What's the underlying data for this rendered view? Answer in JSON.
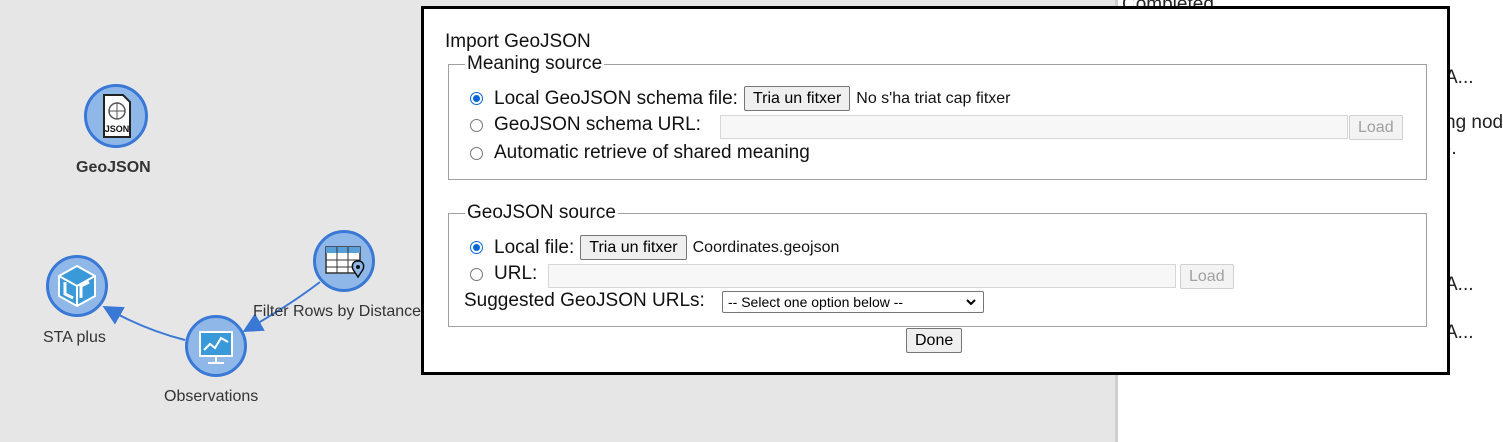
{
  "canvas": {
    "nodes": [
      {
        "label": "GeoJSON",
        "icon": "geojson-file-icon"
      },
      {
        "label": "STA plus",
        "icon": "sta-plus-cube-icon"
      },
      {
        "label": "Filter Rows by Distance",
        "icon": "table-pin-icon"
      },
      {
        "label": "Observations",
        "icon": "line-chart-monitor-icon"
      }
    ],
    "geojson_icon_text": "JSON"
  },
  "right_panel": {
    "line1": "Completed",
    "line2": "A...",
    "line3": "ng node",
    "line4": ").",
    "line5": "A...",
    "line6": "A..."
  },
  "modal": {
    "title": "Import GeoJSON",
    "meaning_source": {
      "legend": "Meaning source",
      "option_local": "Local GeoJSON schema file:",
      "choose_file_label": "Tria un fitxer",
      "no_file_text": "No s'ha triat cap fitxer",
      "option_url": "GeoJSON schema URL:",
      "url_value": "",
      "load_label": "Load",
      "option_auto": "Automatic retrieve of shared meaning",
      "selected": "local"
    },
    "geojson_source": {
      "legend": "GeoJSON source",
      "option_local": "Local file:",
      "choose_file_label": "Tria un fitxer",
      "file_name": "Coordinates.geojson",
      "option_url": "URL:",
      "url_value": "",
      "load_label": "Load",
      "suggested_label": "Suggested GeoJSON URLs:",
      "suggested_selected": "-- Select one option below --",
      "selected": "local"
    },
    "done_label": "Done"
  },
  "colors": {
    "node_fill": "#8fb8e8",
    "node_border": "#3a78d6",
    "edge": "#3a78d6",
    "radio_checked": "#0a66d8",
    "canvas_bg": "#e6e6e6"
  }
}
